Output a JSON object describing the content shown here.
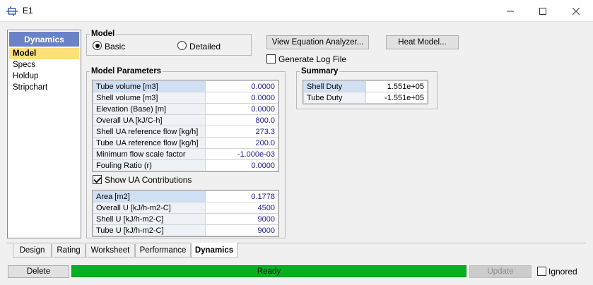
{
  "window": {
    "title": "E1"
  },
  "nav": {
    "header": "Dynamics",
    "items": [
      "Model",
      "Specs",
      "Holdup",
      "Stripchart"
    ]
  },
  "model_group": {
    "title": "Model",
    "options": [
      "Basic",
      "Detailed"
    ],
    "selected": "Basic"
  },
  "buttons": {
    "equation_analyzer": "View Equation Analyzer...",
    "heat_model": "Heat Model...",
    "delete": "Delete",
    "update": "Update"
  },
  "generate_log": {
    "label": "Generate Log File",
    "checked": false
  },
  "model_parameters": {
    "title": "Model Parameters",
    "rows": [
      {
        "label": "Tube volume [m3]",
        "value": "0.0000"
      },
      {
        "label": "Shell volume [m3]",
        "value": "0.0000"
      },
      {
        "label": "Elevation (Base) [m]",
        "value": "0.0000"
      },
      {
        "label": "Overall UA [kJ/C-h]",
        "value": "800.0"
      },
      {
        "label": "Shell UA reference flow [kg/h]",
        "value": "273.3"
      },
      {
        "label": "Tube UA reference flow [kg/h]",
        "value": "200.0"
      },
      {
        "label": "Minimum flow scale factor",
        "value": "-1.000e-03"
      },
      {
        "label": "Fouling Ratio (r)",
        "value": "0.0000"
      }
    ]
  },
  "show_ua": {
    "label": "Show UA Contributions",
    "checked": true
  },
  "ua_table": {
    "rows": [
      {
        "label": "Area [m2]",
        "value": "0.1778"
      },
      {
        "label": "Overall U [kJ/h-m2-C]",
        "value": "4500"
      },
      {
        "label": "Shell U [kJ/h-m2-C]",
        "value": "9000"
      },
      {
        "label": "Tube U [kJ/h-m2-C]",
        "value": "9000"
      }
    ]
  },
  "summary": {
    "title": "Summary",
    "rows": [
      {
        "label": "Shell Duty",
        "value": "1.551e+05"
      },
      {
        "label": "Tube Duty",
        "value": "-1.551e+05"
      }
    ]
  },
  "tabs": [
    "Design",
    "Rating",
    "Worksheet",
    "Performance",
    "Dynamics"
  ],
  "active_tab": "Dynamics",
  "status": {
    "text": "Ready",
    "color": "#06b025"
  },
  "ignored": {
    "label": "Ignored",
    "checked": false
  }
}
